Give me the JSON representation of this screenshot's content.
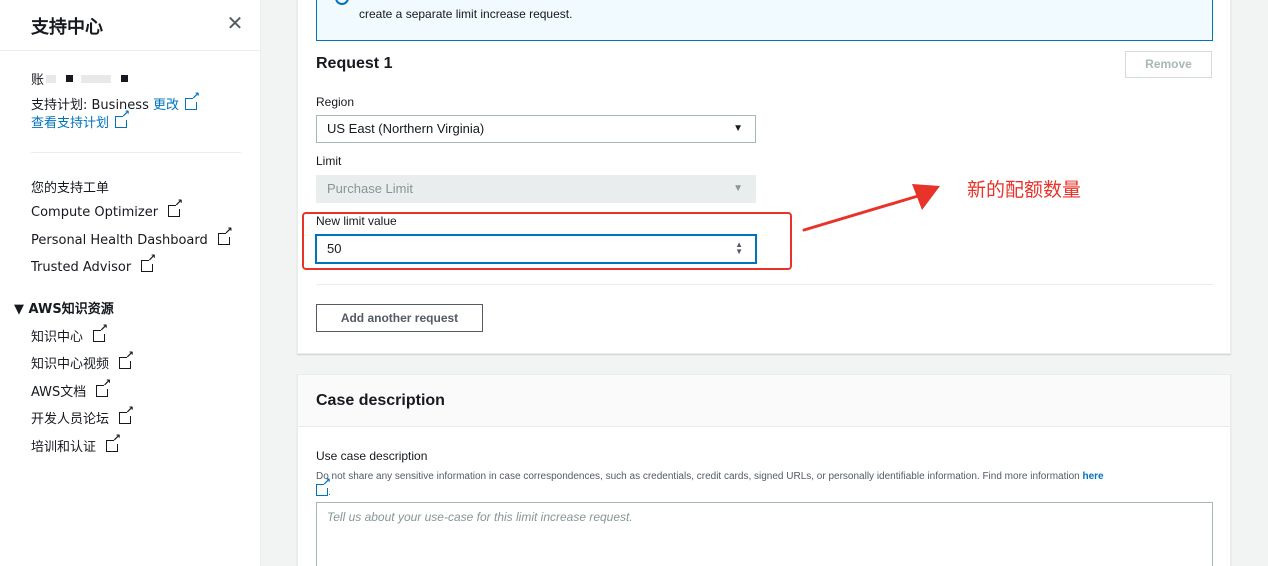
{
  "sidebar": {
    "title": "支持中心",
    "close_glyph": "✕",
    "account_label": "账",
    "plan_label": "支持计划: Business",
    "plan_change_link": "更改",
    "view_plan_link": "查看支持计划",
    "nav_items": [
      {
        "label": "您的支持工单",
        "external": false
      },
      {
        "label": "Compute Optimizer",
        "external": true
      },
      {
        "label": "Personal Health Dashboard",
        "external": true
      },
      {
        "label": "Trusted Advisor",
        "external": true
      }
    ],
    "group_title": "▼ AWS知识资源",
    "group_items": [
      {
        "label": "知识中心"
      },
      {
        "label": "知识中心视频"
      },
      {
        "label": "AWS文档"
      },
      {
        "label": "开发人员论坛"
      },
      {
        "label": "培训和认证"
      }
    ]
  },
  "request_panel": {
    "info_text": "create a separate limit increase request.",
    "title": "Request 1",
    "remove_label": "Remove",
    "region_label": "Region",
    "region_value": "US East (Northern Virginia)",
    "limit_label": "Limit",
    "limit_value": "Purchase Limit",
    "new_limit_label": "New limit value",
    "new_limit_value": "50",
    "add_request_label": "Add another request"
  },
  "case_panel": {
    "title": "Case description",
    "use_case_label": "Use case description",
    "help_text": "Do not share any sensitive information in case correspondences, such as credentials, credit cards, signed URLs, or personally identifiable information. Find more information ",
    "help_link": "here",
    "placeholder": "Tell us about your use-case for this limit increase request."
  },
  "annotation": {
    "text": "新的配额数量",
    "color": "#e8332a"
  },
  "colors": {
    "link": "#0073bb",
    "highlight": "#e8332a"
  }
}
